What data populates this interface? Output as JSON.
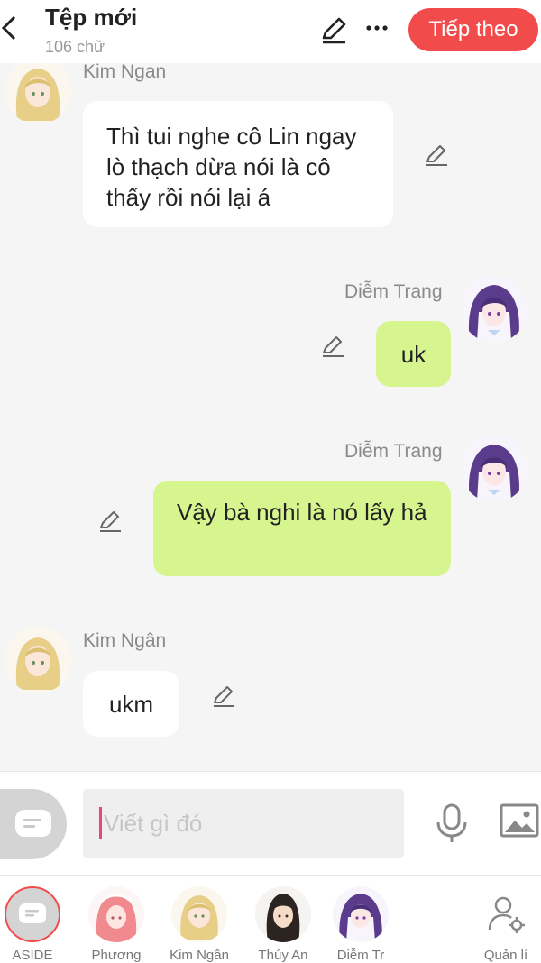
{
  "header": {
    "title": "Tệp mới",
    "word_count": "106 chữ",
    "next_label": "Tiếp theo"
  },
  "messages": [
    {
      "sender": "Kim Ngan",
      "side": "left",
      "text": "Thì tui nghe cô Lin ngay lò thạch dừa nói là cô thấy rồi nói lại á"
    },
    {
      "sender": "Diễm Trang",
      "side": "right",
      "text": "uk"
    },
    {
      "sender": "Diễm Trang",
      "side": "right",
      "text": "Vậy bà nghi là nó lấy hả"
    },
    {
      "sender": "Kim Ngân",
      "side": "left",
      "text": "ukm"
    }
  ],
  "composer": {
    "placeholder": "Viết gì đó"
  },
  "tabs": [
    {
      "label": "ASIDE"
    },
    {
      "label": "Phương"
    },
    {
      "label": "Kim Ngân"
    },
    {
      "label": "Thúy An"
    },
    {
      "label": "Diễm Tr"
    },
    {
      "label": "Quản lí"
    }
  ],
  "colors": {
    "accent": "#f24b4b",
    "bubble_right": "#d6f58e",
    "bubble_left": "#ffffff",
    "background": "#f5f5f5"
  }
}
